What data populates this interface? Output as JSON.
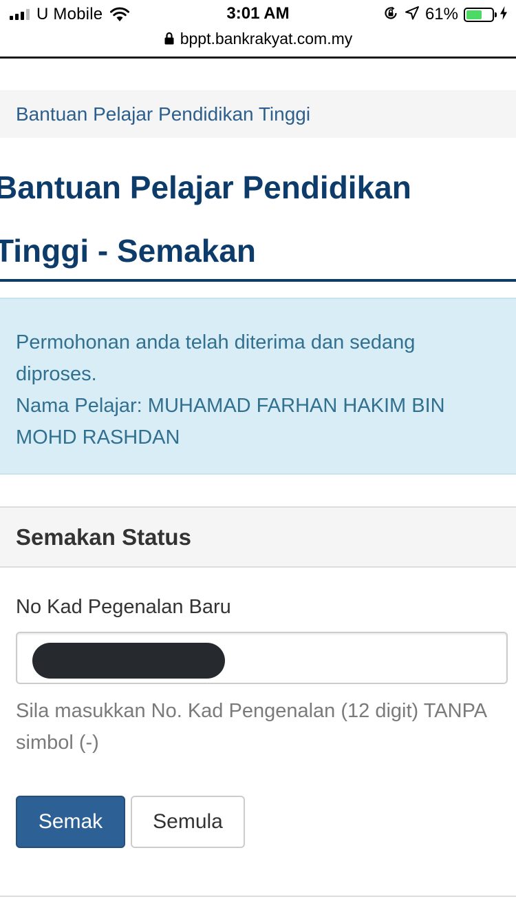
{
  "status_bar": {
    "carrier": "U Mobile",
    "time": "3:01 AM",
    "battery_percent": "61%",
    "battery_level": 0.61,
    "battery_color": "#4cd964"
  },
  "browser": {
    "url": "bppt.bankrakyat.com.my"
  },
  "breadcrumb": {
    "label": "Bantuan Pelajar Pendidikan Tinggi"
  },
  "page": {
    "title": "Bantuan Pelajar Pendidikan Tinggi - Semakan",
    "title_color": "#0d3c6b"
  },
  "alert": {
    "message": "Permohonan anda telah diterima dan sedang diproses.",
    "student_name": "Nama Pelajar: MUHAMAD FARHAN HAKIM BIN MOHD RASHDAN"
  },
  "panel": {
    "heading": "Semakan Status",
    "field_label": "No Kad Pegenalan Baru",
    "field_value": "",
    "help_text": "Sila masukkan No. Kad Pengenalan (12 digit) TANPA simbol (-)",
    "submit_label": "Semak",
    "reset_label": "Semula",
    "primary_color": "#2d6195"
  }
}
